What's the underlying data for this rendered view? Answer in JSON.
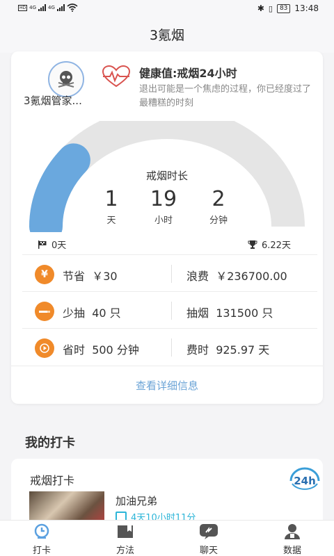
{
  "status_bar": {
    "left": "HD 4G 4G",
    "time": "13:48",
    "battery": "83"
  },
  "header": {
    "title": "3氪烟"
  },
  "profile": {
    "username": "3氪烟管家..."
  },
  "health": {
    "title": "健康值:戒烟24小时",
    "description": "退出可能是一个焦虑的过程，你已经度过了最糟糕的时刻"
  },
  "gauge": {
    "label": "戒烟时长",
    "progress": 0.22,
    "days": "1",
    "days_unit": "天",
    "hours": "19",
    "hours_unit": "小时",
    "minutes": "2",
    "minutes_unit": "分钟",
    "start": "0天",
    "goal": "6.22天",
    "colors": {
      "fill": "#6aa8de",
      "track": "#e5e5e5"
    }
  },
  "stats": [
    {
      "icon": "yen-icon",
      "left_label": "节省",
      "left_value": "￥30",
      "right_label": "浪费",
      "right_value": "￥236700.00"
    },
    {
      "icon": "cigarette-icon",
      "left_label": "少抽",
      "left_value": "40 只",
      "right_label": "抽烟",
      "right_value": "131500 只"
    },
    {
      "icon": "play-icon",
      "left_label": "省时",
      "left_value": "500 分钟",
      "right_label": "费时",
      "right_value": "925.97 天"
    }
  ],
  "detail_link": "查看详细信息",
  "checkin": {
    "section_title": "我的打卡",
    "card_title": "戒烟打卡",
    "badge": "24h",
    "message": "加油兄弟",
    "streak": "4天10小时11分"
  },
  "nav": [
    {
      "label": "打卡",
      "icon": "clock-icon",
      "active": true
    },
    {
      "label": "方法",
      "icon": "book-icon",
      "active": false
    },
    {
      "label": "聊天",
      "icon": "chat-icon",
      "active": false
    },
    {
      "label": "数据",
      "icon": "user-icon",
      "active": false
    }
  ],
  "accent": "#f08a2a"
}
